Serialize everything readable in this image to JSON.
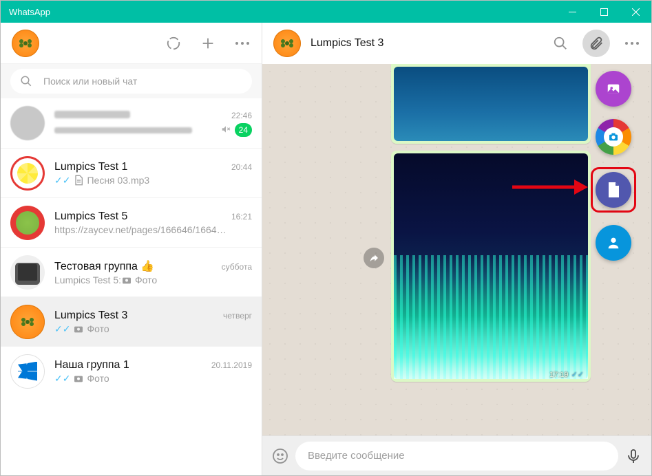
{
  "titlebar": {
    "title": "WhatsApp"
  },
  "left": {
    "search_placeholder": "Поиск или новый чат",
    "chats": [
      {
        "name": "",
        "preview": "",
        "time": "22:46",
        "unread": "24",
        "muted": true
      },
      {
        "name": "Lumpics Test 1",
        "preview": "Песня 03.mp3",
        "time": "20:44",
        "ticks": true,
        "file": true
      },
      {
        "name": "Lumpics Test 5",
        "preview": "https://zaycev.net/pages/166646/1664…",
        "time": "16:21"
      },
      {
        "name": "Тестовая группа 👍",
        "preview": "Lumpics Test 5: ",
        "photo_label": "Фото",
        "time": "суббота",
        "photo": true
      },
      {
        "name": "Lumpics Test 3",
        "preview": "",
        "photo_label": "Фото",
        "time": "четверг",
        "ticks": true,
        "photo": true,
        "active": true
      },
      {
        "name": "Наша группа 1",
        "preview": "",
        "photo_label": "Фото",
        "time": "20.11.2019",
        "ticks": true,
        "photo": true
      }
    ]
  },
  "right": {
    "chat_name": "Lumpics Test 3",
    "message_placeholder": "Введите сообщение",
    "msg_time": "17:19",
    "attach_menu": {
      "photo": "photo-video",
      "camera": "camera",
      "document": "document",
      "contact": "contact"
    }
  }
}
